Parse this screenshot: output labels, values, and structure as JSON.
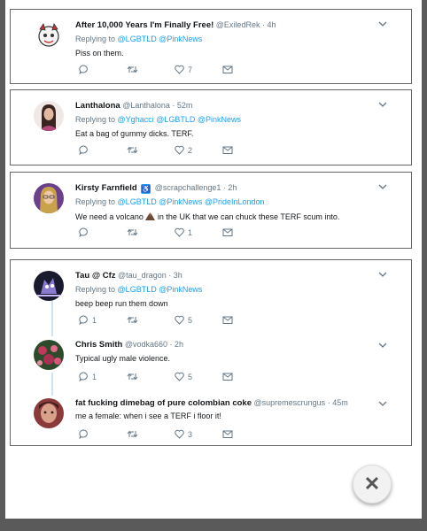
{
  "tweets": [
    {
      "name": "After 10,000 Years I'm Finally Free!",
      "handle": "@ExiledRek",
      "time": "· 4h",
      "reply_prefix": "Replying to",
      "reply_to": "@LGBTLD @PinkNews",
      "text": "Piss on them.",
      "reply_count": "",
      "like_count": "7"
    },
    {
      "name": "Lanthalona",
      "handle": "@Lanthalona",
      "time": "· 52m",
      "reply_prefix": "Replying to",
      "reply_to": "@Yghacci @LGBTLD @PinkNews",
      "text": "Eat a bag of gummy dicks. TERF.",
      "reply_count": "",
      "like_count": "2"
    },
    {
      "name": "Kirsty Farnfield",
      "badge": "♿",
      "handle": "@scrapchallenge1",
      "time": "· 2h",
      "reply_prefix": "Replying to",
      "reply_to": "@LGBTLD @PinkNews @PrideInLondon",
      "text_before": "We need a volcano",
      "text_after": "in the UK that we can chuck these TERF scum into.",
      "reply_count": "",
      "like_count": "1"
    },
    {
      "name": "Tau @ Cfz",
      "handle": "@tau_dragon",
      "time": "· 3h",
      "reply_prefix": "Replying to",
      "reply_to": "@LGBTLD @PinkNews",
      "text": "beep beep run them down",
      "reply_count": "1",
      "like_count": "5"
    },
    {
      "name": "Chris Smith",
      "handle": "@vodka660",
      "time": "· 2h",
      "text": "Typical ugly male violence.",
      "reply_count": "1",
      "like_count": "5"
    },
    {
      "name": "fat fucking dimebag of pure colombian coke",
      "handle": "@supremescrungus",
      "time": "· 45m",
      "text": "me a female: when i see a TERF i floor it!",
      "reply_count": "",
      "like_count": "3"
    }
  ],
  "close_label": "✕",
  "colors": {
    "accent": "#1da1f2",
    "name": "#14171a",
    "muted": "#657786",
    "thread": "#cfe3f3"
  },
  "icons": [
    "avatar-icon",
    "chevron-down-icon",
    "reply-icon",
    "retweet-icon",
    "like-icon",
    "message-icon",
    "volcano-icon",
    "close-icon"
  ]
}
